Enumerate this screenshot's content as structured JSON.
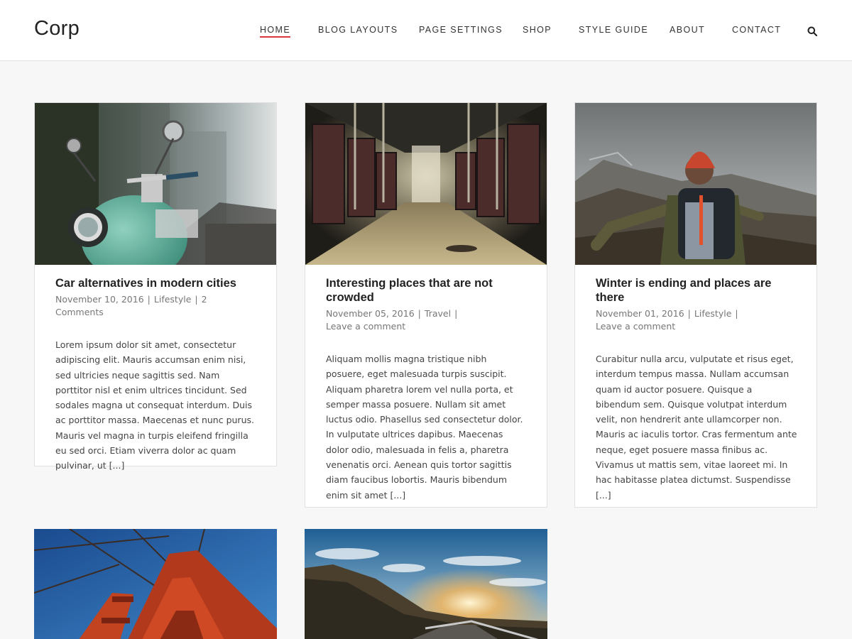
{
  "site": {
    "logo": "Corp"
  },
  "nav": {
    "items": [
      {
        "label": "HOME",
        "active": true
      },
      {
        "label": "BLOG LAYOUTS"
      },
      {
        "label": "PAGE SETTINGS"
      },
      {
        "label": "SHOP"
      },
      {
        "label": "STYLE GUIDE"
      },
      {
        "label": "ABOUT"
      },
      {
        "label": "CONTACT"
      }
    ],
    "search_icon": "search-icon",
    "accent_color": "#d9353c"
  },
  "posts": [
    {
      "title": "Car alternatives in modern cities",
      "date": "November 10, 2016",
      "category": "Lifestyle",
      "comments": "2 Comments",
      "excerpt": "Lorem ipsum dolor sit amet, consectetur adipiscing elit. Mauris accumsan enim nisi, sed ultricies neque sagittis sed. Nam porttitor nisl et enim ultrices tincidunt. Sed sodales magna ut consequat interdum. Duis ac porttitor massa. Maecenas et nunc purus. Mauris vel magna in turpis eleifend fringilla eu sed orci. Etiam viverra dolor ac quam pulvinar, ut [...]"
    },
    {
      "title": "Interesting places that are not crowded",
      "date": "November 05, 2016",
      "category": "Travel",
      "comments": "Leave a comment",
      "excerpt": "Aliquam mollis magna tristique nibh posuere, eget malesuada turpis suscipit. Aliquam pharetra lorem vel nulla porta, et semper massa posuere. Nullam sit amet luctus odio. Phasellus sed consectetur dolor. In vulputate ultrices dapibus. Maecenas dolor odio, malesuada in felis a, pharetra venenatis orci. Aenean quis tortor sagittis diam faucibus lobortis. Mauris bibendum enim sit amet [...]"
    },
    {
      "title": "Winter is ending and places are there",
      "date": "November 01, 2016",
      "category": "Lifestyle",
      "comments": "Leave a comment",
      "excerpt": "Curabitur nulla arcu, vulputate et risus eget, interdum tempus massa. Nullam accumsan quam id auctor posuere. Quisque a bibendum sem. Quisque volutpat interdum velit, non hendrerit ante ullamcorper non. Mauris ac iaculis tortor. Cras fermentum ante neque, eget posuere massa finibus ac. Vivamus ut mattis sem, vitae laoreet mi. In hac habitasse platea dictumst. Suspendisse [...]"
    }
  ]
}
